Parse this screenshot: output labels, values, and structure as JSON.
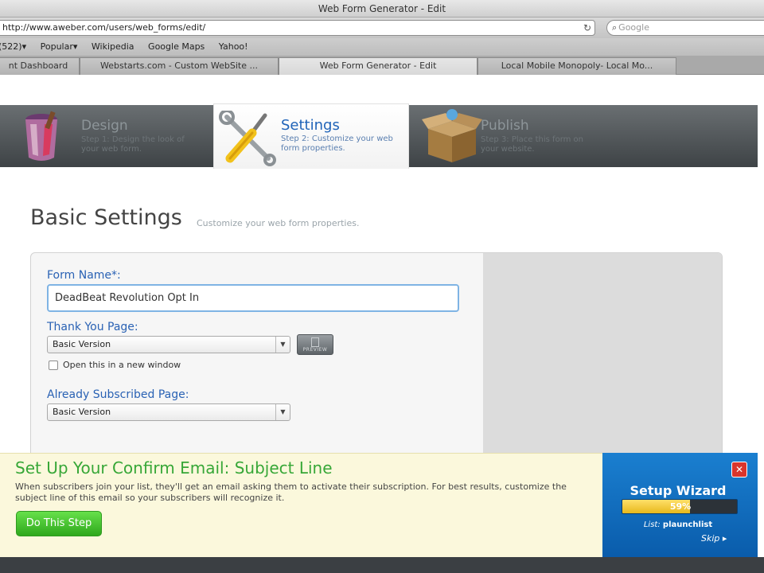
{
  "window": {
    "title": "Web Form Generator - Edit"
  },
  "browser": {
    "url": "http://www.aweber.com/users/web_forms/edit/",
    "search_placeholder": "Google",
    "reload_glyph": "↻",
    "bookmarks": [
      "(522)▾",
      "Popular▾",
      "Wikipedia",
      "Google Maps",
      "Yahoo!"
    ],
    "tabs": [
      {
        "label": "nt Dashboard"
      },
      {
        "label": "Webstarts.com - Custom WebSite ..."
      },
      {
        "label": "Web Form Generator - Edit",
        "active": true
      },
      {
        "label": "Local Mobile Monopoly- Local Mo..."
      }
    ]
  },
  "steps": [
    {
      "title": "Design",
      "desc": "Step 1: Design the look of your web form.",
      "icon": "paint-bucket-icon"
    },
    {
      "title": "Settings",
      "desc": "Step 2: Customize your web form properties.",
      "icon": "tools-icon",
      "active": true
    },
    {
      "title": "Publish",
      "desc": "Step 3: Place this form on your website.",
      "icon": "box-icon"
    }
  ],
  "page": {
    "heading": "Basic Settings",
    "subheading": "Customize your web form properties."
  },
  "form": {
    "form_name_label": "Form Name*:",
    "form_name_value": "DeadBeat Revolution Opt In",
    "thank_you_label": "Thank You Page:",
    "thank_you_value": "Basic Version",
    "preview_label": "PREVIEW",
    "new_window_label": "Open this in a new window",
    "new_window_checked": false,
    "already_subscribed_label": "Already Subscribed Page:",
    "already_subscribed_value": "Basic Version"
  },
  "setup_bar": {
    "title": "Set Up Your Confirm Email: Subject Line",
    "description": "When subscribers join your list, they'll get an email asking them to activate their subscription. For best results, customize the subject line of this email so your subscribers will recognize it.",
    "button_label": "Do This Step"
  },
  "wizard": {
    "title": "Setup Wizard",
    "progress": 0.59,
    "progress_label": "59%",
    "list_prefix": "List:",
    "list_name": "plaunchlist",
    "skip_label": "Skip ▸",
    "close_glyph": "✕",
    "colors": {
      "panel": "#0a5cab",
      "progress": "#e7b81c",
      "close": "#d9352c"
    }
  },
  "colors": {
    "accent": "#1f63b8",
    "heading": "#444444",
    "success": "#37a737"
  }
}
